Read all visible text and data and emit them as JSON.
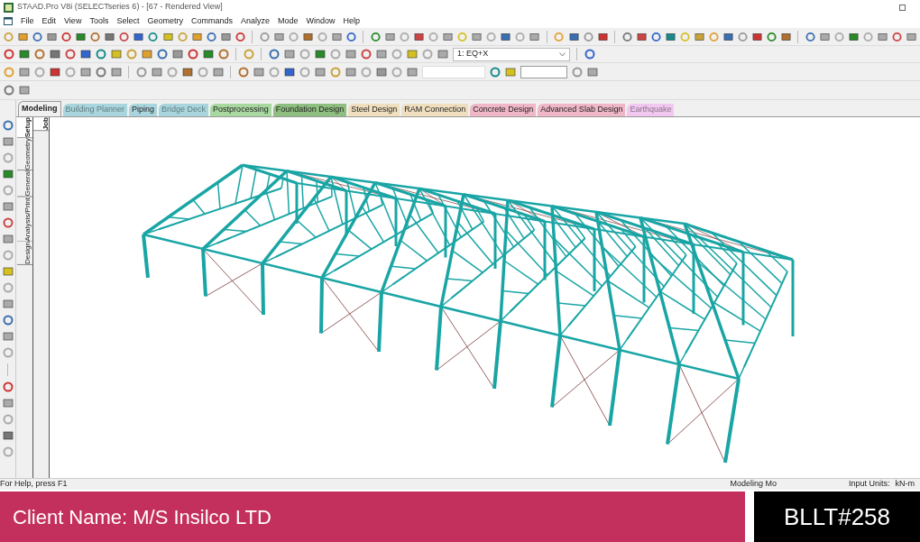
{
  "window": {
    "title": "STAAD.Pro V8i (SELECTseries 6) - [67 - Rendered View]"
  },
  "menu": [
    "File",
    "Edit",
    "View",
    "Tools",
    "Select",
    "Geometry",
    "Commands",
    "Analyze",
    "Mode",
    "Window",
    "Help"
  ],
  "load_case": {
    "value": "1: EQ+X"
  },
  "mode_tabs": [
    {
      "label": "Modeling",
      "color": "#f0f0f0",
      "selected": true,
      "disabled": false
    },
    {
      "label": "Building Planner",
      "color": "#a9d6de",
      "selected": false,
      "disabled": true
    },
    {
      "label": "Piping",
      "color": "#a9d6de",
      "selected": false,
      "disabled": false
    },
    {
      "label": "Bridge Deck",
      "color": "#a9d6de",
      "selected": false,
      "disabled": true
    },
    {
      "label": "Postprocessing",
      "color": "#a8d8a0",
      "selected": false,
      "disabled": false
    },
    {
      "label": "Foundation Design",
      "color": "#8fbf80",
      "selected": false,
      "disabled": false
    },
    {
      "label": "Steel Design",
      "color": "#efdfbf",
      "selected": false,
      "disabled": false
    },
    {
      "label": "RAM Connection",
      "color": "#efdfbf",
      "selected": false,
      "disabled": false
    },
    {
      "label": "Concrete Design",
      "color": "#efb7c8",
      "selected": false,
      "disabled": false
    },
    {
      "label": "Advanced Slab Design",
      "color": "#efb7c8",
      "selected": false,
      "disabled": false
    },
    {
      "label": "Earthquake",
      "color": "#f2c8f0",
      "selected": false,
      "disabled": true
    }
  ],
  "page_tabs": [
    {
      "label": "Setup",
      "selected": true
    },
    {
      "label": "Geometry",
      "selected": false
    },
    {
      "label": "General",
      "selected": false
    },
    {
      "label": "Analysis/Print",
      "selected": false
    },
    {
      "label": "Design",
      "selected": false
    }
  ],
  "sub_tabs": [
    {
      "label": "Job",
      "selected": true
    }
  ],
  "status_bar": {
    "help": "For Help, press F1",
    "mode": "Modeling Mo",
    "units_label": "Input Units:",
    "units": "kN-m"
  },
  "banner": {
    "client": "Client Name: M/S Insilco LTD",
    "code": "BLLT#258"
  }
}
